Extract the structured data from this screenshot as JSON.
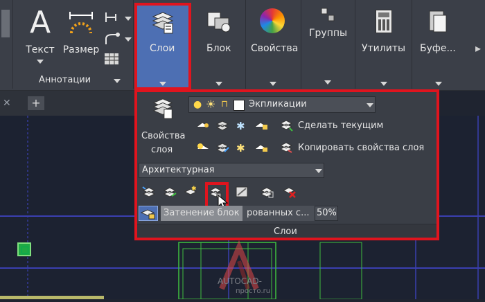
{
  "ribbon": {
    "text_label": "Текст",
    "dim_label": "Размер",
    "annot_panel": "Аннотации",
    "layers_label": "Слои",
    "block_label": "Блок",
    "props_label": "Свойства",
    "groups_label": "Группы",
    "utils_label": "Утилиты",
    "clip_label": "Буфе..."
  },
  "flyout": {
    "layer_props_line1": "Свойства",
    "layer_props_line2": "слоя",
    "layer_combo_value": "Экпликации",
    "make_current": "Сделать текущим",
    "copy_props": "Копировать свойства слоя",
    "arch_combo_value": "Архитектурная",
    "fade_field": "Затенение блок",
    "fade_field2": "рованных с...",
    "fade_percent": "50%",
    "panel_title": "Слои"
  },
  "colors": {
    "accent_red": "#e0141e",
    "ribbon_bg": "#3b3f48",
    "active_tab": "#4d6fb3",
    "grid_line": "#3a3fb0"
  },
  "watermark": {
    "line1": "AUTOCAD-",
    "line2": "просто.ru"
  }
}
